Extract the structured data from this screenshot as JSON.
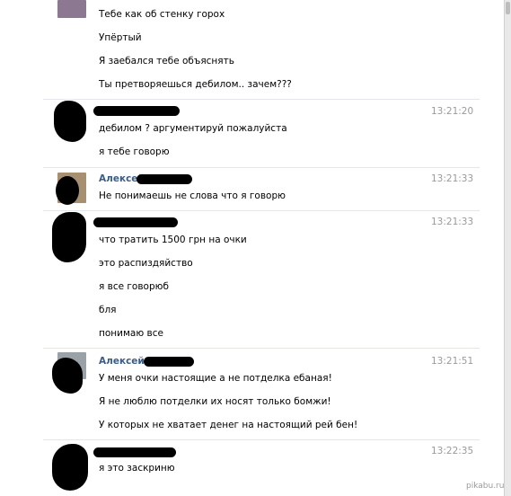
{
  "messages": {
    "group0": [
      "Тебе как об стенку горох",
      "Упёртый",
      "Я заебался тебе объяснять",
      "Ты претворяешься дебилом.. зачем???"
    ],
    "group1": {
      "time": "13:21:20",
      "lines": [
        "дебилом ? аргументируй пожалуйста",
        "я тебе говорю"
      ]
    },
    "group2": {
      "name": "Алексей",
      "time": "13:21:33",
      "lines": [
        "Не понимаешь не слова что я говорю"
      ]
    },
    "group3": {
      "time": "13:21:33",
      "lines": [
        "что тратить 1500 грн на очки",
        "это распиздяйство",
        "я все говорюб",
        "бля",
        "понимаю все"
      ]
    },
    "group4": {
      "name": "Алексей",
      "time": "13:21:51",
      "lines": [
        "У меня очки настоящие а не потделка ебаная!",
        "Я не люблю потделки их носят только бомжи!",
        "У которых не хватает денег на настоящий рей бен!"
      ]
    },
    "group5": {
      "time": "13:22:35",
      "lines": [
        "я это заскриню"
      ]
    }
  },
  "watermark": "pikabu.ru",
  "colors": {
    "name": "#3b5d85",
    "time": "#9a9a9a",
    "separator": "#e3e7ec"
  }
}
